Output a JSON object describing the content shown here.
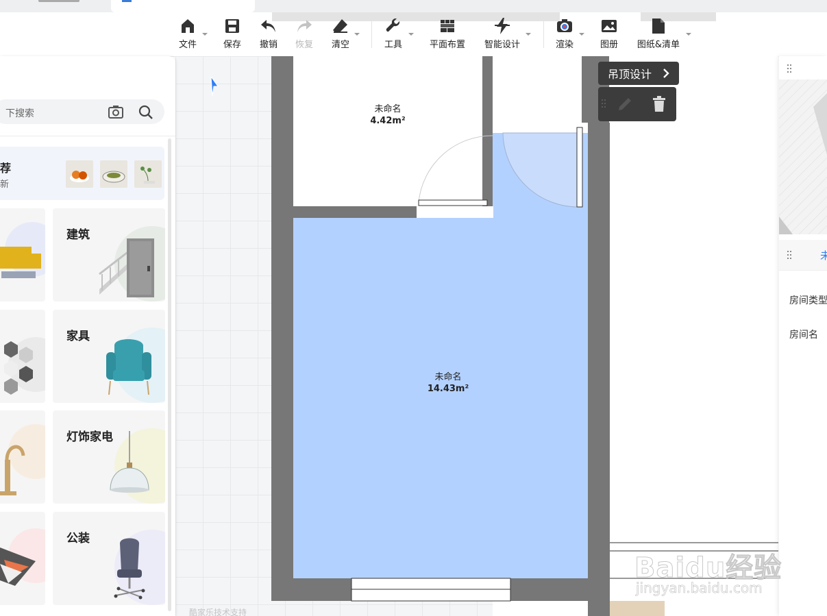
{
  "toolbar": {
    "items": [
      {
        "label": "文件",
        "icon": "home-icon",
        "has_menu": true
      },
      {
        "label": "保存",
        "icon": "save-icon",
        "has_menu": false
      },
      {
        "label": "撤销",
        "icon": "undo-icon",
        "has_menu": false
      },
      {
        "label": "恢复",
        "icon": "redo-icon",
        "has_menu": false,
        "disabled": true
      },
      {
        "label": "清空",
        "icon": "eraser-icon",
        "has_menu": true
      },
      {
        "label": "工具",
        "icon": "wrench-icon",
        "has_menu": true
      },
      {
        "label": "平面布置",
        "icon": "layout-grid-icon",
        "has_menu": false
      },
      {
        "label": "智能设计",
        "icon": "lightning-icon",
        "has_menu": true
      },
      {
        "label": "渲染",
        "icon": "camera-icon",
        "has_menu": true
      },
      {
        "label": "图册",
        "icon": "album-icon",
        "has_menu": false
      },
      {
        "label": "图纸&清单",
        "icon": "document-icon",
        "has_menu": true
      }
    ]
  },
  "left_panel": {
    "search_placeholder": "下搜索",
    "recommend": {
      "title": "荐",
      "subtitle": "新"
    },
    "categories": [
      {
        "label": "建筑"
      },
      {
        "label": "家具"
      },
      {
        "label": "灯饰家电"
      },
      {
        "label": "公装"
      }
    ]
  },
  "canvas": {
    "rooms": [
      {
        "name": "未命名",
        "area": "4.42m²"
      },
      {
        "name": "未命名",
        "area": "14.43m²"
      }
    ],
    "credit": "酷家乐技术支持",
    "room_fill_color": "#b3d1ff",
    "wall_color": "#777777"
  },
  "context_menu": {
    "ceiling_design": "吊顶设计"
  },
  "right_panel": {
    "tab_label": "未",
    "room_type_label": "房间类型",
    "room_name_label": "房间名"
  },
  "watermark": {
    "brand": "Baidu经验",
    "url": "jingyan.baidu.com"
  }
}
